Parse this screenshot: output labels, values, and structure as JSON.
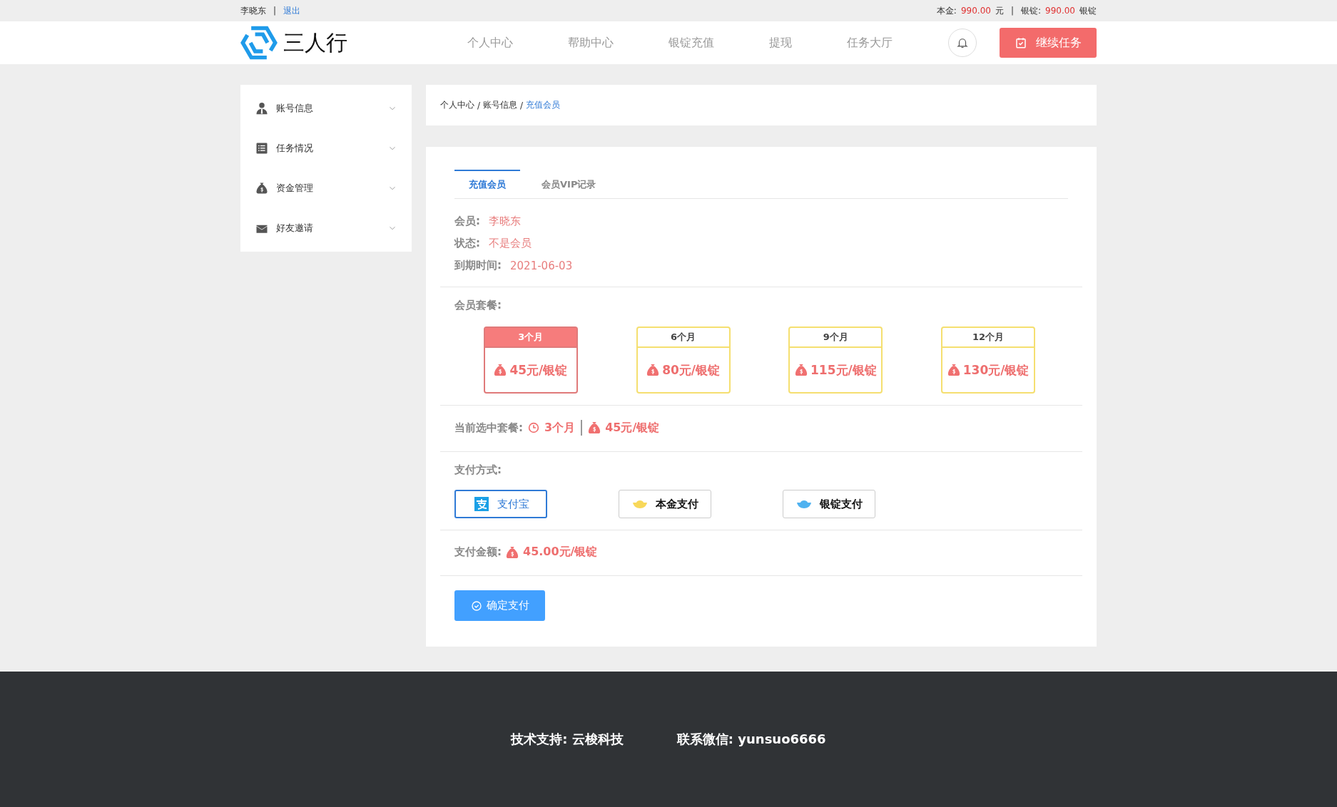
{
  "top_bar": {
    "user": "李晓东",
    "separator": "|",
    "logout": "退出",
    "balance": [
      {
        "label": "本金:",
        "value": "990.00",
        "unit": "元"
      },
      {
        "label": "银锭:",
        "value": "990.00",
        "unit": "银锭"
      }
    ],
    "balance_separator": "|"
  },
  "header": {
    "logo_text": "三人行",
    "nav": [
      "个人中心",
      "帮助中心",
      "银锭充值",
      "提现",
      "任务大厅"
    ],
    "action_button": "继续任务"
  },
  "sidebar": {
    "items": [
      {
        "label": "账号信息",
        "expanded": false
      },
      {
        "label": "任务情况",
        "expanded": false
      },
      {
        "label": "资金管理",
        "expanded": false
      },
      {
        "label": "好友邀请",
        "expanded": false
      }
    ]
  },
  "breadcrumb_separator": "/",
  "breadcrumb": [
    {
      "label": "个人中心",
      "current": false
    },
    {
      "label": "账号信息",
      "current": false
    },
    {
      "label": "充值会员",
      "current": true
    }
  ],
  "tabs": [
    {
      "label": "充值会员",
      "selected": true
    },
    {
      "label": "会员VIP记录",
      "selected": false
    }
  ],
  "member_info": [
    {
      "label": "会员:",
      "value": "李晓东"
    },
    {
      "label": "状态:",
      "value": "不是会员"
    },
    {
      "label": "到期时间:",
      "value": "2021-06-03"
    }
  ],
  "packages": {
    "label": "会员套餐:",
    "items": [
      {
        "period": "3个月",
        "price": "45元/银锭",
        "selected": true
      },
      {
        "period": "6个月",
        "price": "80元/银锭",
        "selected": false
      },
      {
        "period": "9个月",
        "price": "115元/银锭",
        "selected": false
      },
      {
        "period": "12个月",
        "price": "130元/银锭",
        "selected": false
      }
    ]
  },
  "current_selection": {
    "label": "当前选中套餐:",
    "period": "3个月",
    "price": "45元/银锭"
  },
  "payment": {
    "label": "支付方式:",
    "methods": [
      {
        "label": "支付宝",
        "kind": "alipay",
        "selected": true
      },
      {
        "label": "本金支付",
        "kind": "gold",
        "selected": false
      },
      {
        "label": "银锭支付",
        "kind": "silver",
        "selected": false
      }
    ]
  },
  "amount": {
    "label": "支付金额:",
    "value": "45.00元/银锭"
  },
  "confirm_button": "确定支付",
  "footer": [
    "技术支持: 云梭科技",
    "联系微信: yunsuo6666"
  ]
}
